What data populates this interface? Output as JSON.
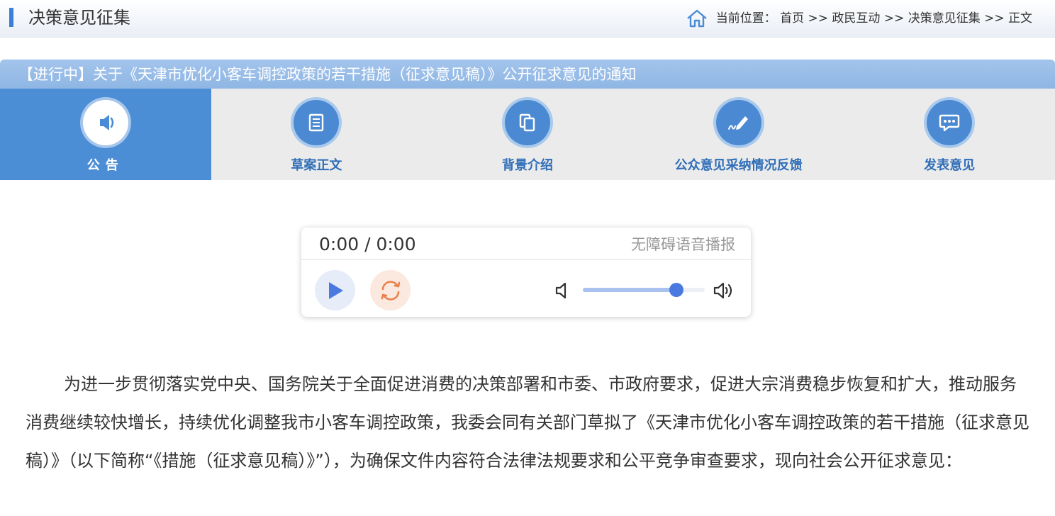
{
  "header": {
    "section_title": "决策意见征集",
    "breadcrumb_prefix": "当前位置：",
    "breadcrumb": [
      {
        "label": "首页"
      },
      {
        "label": "政民互动"
      },
      {
        "label": "决策意见征集"
      },
      {
        "label": "正文"
      }
    ],
    "separator": " >> "
  },
  "notice": {
    "title": "【进行中】关于《天津市优化小客车调控政策的若干措施（征求意见稿）》公开征求意见的通知"
  },
  "tabs": [
    {
      "label": "公告",
      "icon": "megaphone-icon",
      "active": true
    },
    {
      "label": "草案正文",
      "icon": "document-icon",
      "active": false
    },
    {
      "label": "背景介绍",
      "icon": "copy-pages-icon",
      "active": false
    },
    {
      "label": "公众意见采纳情况反馈",
      "icon": "pen-write-icon",
      "active": false
    },
    {
      "label": "发表意见",
      "icon": "chat-bubble-icon",
      "active": false
    }
  ],
  "player": {
    "time": "0:00 / 0:00",
    "label": "无障碍语音播报",
    "volume_fraction": 0.77,
    "colors": {
      "play": "#4a7ae0",
      "replay": "#e8834e"
    }
  },
  "content": {
    "paragraph": "为进一步贯彻落实党中央、国务院关于全面促进消费的决策部署和市委、市政府要求，促进大宗消费稳步恢复和扩大，推动服务消费继续较快增长，持续优化调整我市小客车调控政策，我委会同有关部门草拟了《天津市优化小客车调控政策的若干措施（征求意见稿）》（以下简称“《措施（征求意见稿）》”），为确保文件内容符合法律法规要求和公平竞争审查要求，现向社会公开征求意见："
  },
  "colors": {
    "accent": "#3b7fd6",
    "active_tab": "#4c8ed5",
    "tab_text": "#2f6eb8"
  }
}
